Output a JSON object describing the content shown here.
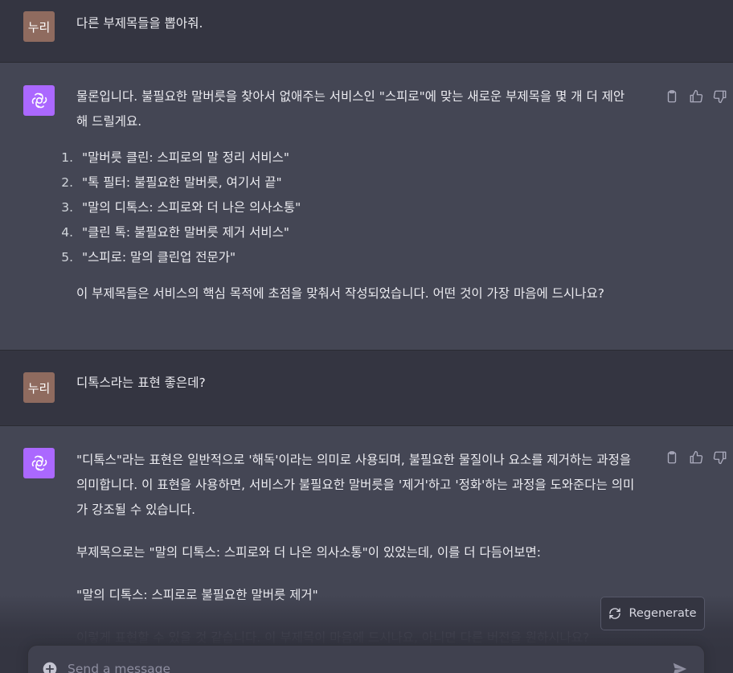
{
  "conversation": {
    "m1": {
      "avatar": "누리",
      "text": "다른 부제목들을 뽑아줘."
    },
    "m2": {
      "avatar_icon": "openai-logo-icon",
      "intro_line1": "물론입니다. 불필요한 말버릇을 찾아서 없애주는 서비스인 \"스피로\"에 맞는 새로운 부제목을 몇 개 더 제안",
      "intro_line2": "해 드릴게요.",
      "items": [
        {
          "num": "1.",
          "text": "\"말버릇 클린: 스피로의 말 정리 서비스\""
        },
        {
          "num": "2.",
          "text": "\"톡 필터: 불필요한 말버릇, 여기서 끝\""
        },
        {
          "num": "3.",
          "text": "\"말의 디톡스: 스피로와 더 나은 의사소통\""
        },
        {
          "num": "4.",
          "text": "\"클린 톡: 불필요한 말버릇 제거 서비스\""
        },
        {
          "num": "5.",
          "text": "\"스피로: 말의 클린업 전문가\""
        }
      ],
      "outro": "이 부제목들은 서비스의 핵심 목적에 초점을 맞춰서 작성되었습니다. 어떤 것이 가장 마음에 드시나요?"
    },
    "m3": {
      "avatar": "누리",
      "text": "디톡스라는 표현 좋은데?"
    },
    "m4": {
      "line1": "\"디톡스\"라는 표현은 일반적으로 '해독'이라는 의미로 사용되며, 불필요한 물질이나 요소를 제거하는 과정을",
      "line2": "의미합니다. 이 표현을 사용하면, 서비스가 불필요한 말버릇을 '제거'하고 '정화'하는 과정을 도와준다는 의미",
      "line3": "가 강조될 수 있습니다.",
      "para2": "부제목으로는 \"말의 디톡스: 스피로와 더 나은 의사소통\"이 있었는데, 이를 더 다듬어보면:",
      "para3": "\"말의 디톡스: 스피로로 불필요한 말버릇 제거\"",
      "para4": "이렇게 표현할 수 있을 것 같습니다. 이 부제목이 마음에 드시나요, 아니면 다른 버전을 원하시나요?"
    }
  },
  "actions": {
    "icons": [
      "clipboard-icon",
      "thumbs-up-icon",
      "thumbs-down-icon"
    ]
  },
  "regenerate": {
    "label": "Regenerate",
    "icon": "refresh-icon"
  },
  "composer": {
    "placeholder": "Send a message",
    "plus_icon": "plus-circle-icon",
    "send_icon": "send-icon"
  },
  "colors": {
    "background": "#343541",
    "assistant_bg": "#444654",
    "user_avatar": "#8f6b5f",
    "ai_avatar": "#ab68ff"
  }
}
